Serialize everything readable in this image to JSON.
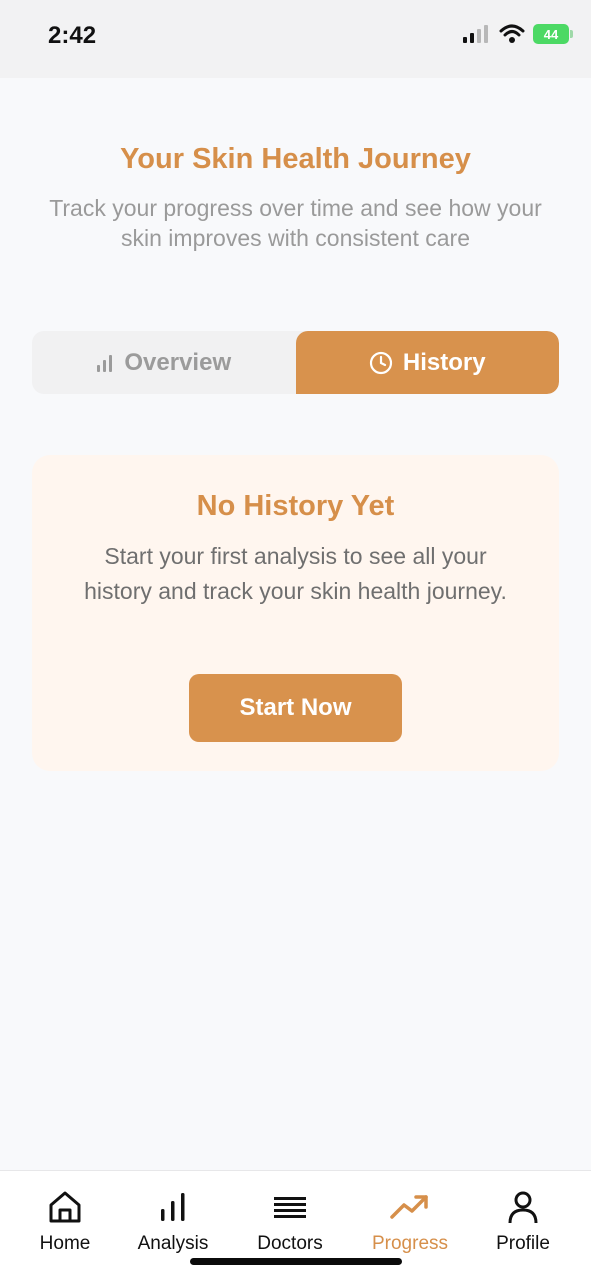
{
  "status_bar": {
    "time": "2:42",
    "battery_level": "44"
  },
  "header": {
    "title": "Your Skin Health Journey",
    "subtitle": "Track your progress over time and see how your skin improves with consistent care"
  },
  "segmented_control": {
    "tabs": [
      {
        "label": "Overview",
        "icon": "bar-chart-icon",
        "selected": false
      },
      {
        "label": "History",
        "icon": "clock-icon",
        "selected": true
      }
    ]
  },
  "empty_state": {
    "title": "No History Yet",
    "message": "Start your first analysis to see all your history and track your skin health journey.",
    "button_label": "Start Now"
  },
  "tab_bar": {
    "items": [
      {
        "label": "Home",
        "icon": "home-icon",
        "active": false
      },
      {
        "label": "Analysis",
        "icon": "bar-chart-icon",
        "active": false
      },
      {
        "label": "Doctors",
        "icon": "list-icon",
        "active": false
      },
      {
        "label": "Progress",
        "icon": "trending-up-icon",
        "active": true
      },
      {
        "label": "Profile",
        "icon": "user-icon",
        "active": false
      }
    ]
  },
  "colors": {
    "accent": "#d68f4a",
    "background": "#f8f9fb",
    "card_background": "#fff6ef"
  }
}
